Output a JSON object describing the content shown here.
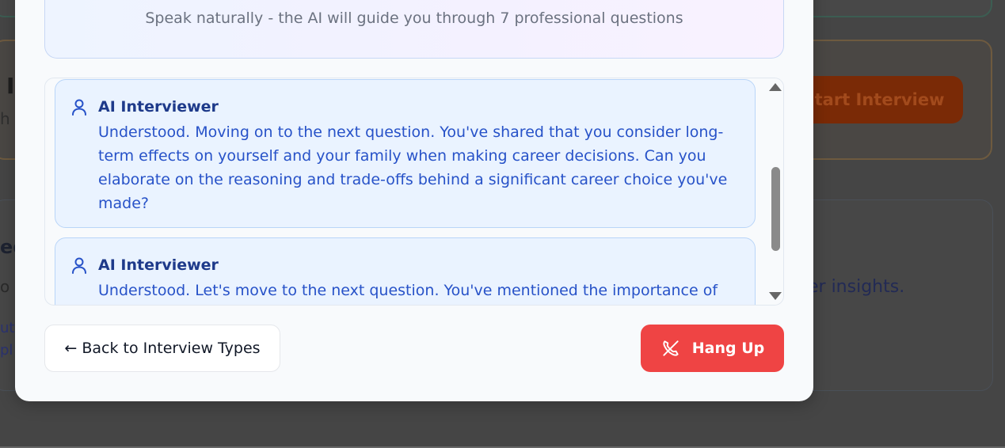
{
  "background": {
    "heading_fragment": "I",
    "sub_fragment": "h",
    "start_button_label": "Start Interview",
    "section_fragment": "ed",
    "small_fragment1": "o",
    "small_fragment2": "ut",
    "small_fragment3": "pl",
    "insights_fragment": "er insights."
  },
  "modal": {
    "instruction": "Speak naturally - the AI will guide you through 7 professional questions",
    "messages": [
      {
        "sender": "AI Interviewer",
        "text": "Understood. Moving on to the next question. You've shared that you consider long-term effects on yourself and your family when making career decisions. Can you elaborate on the reasoning and trade-offs behind a significant career choice you've made?"
      },
      {
        "sender": "AI Interviewer",
        "text": "Understood. Let's move to the next question. You've mentioned the importance of"
      }
    ],
    "back_button_label": "← Back to Interview Types",
    "hangup_button_label": "Hang Up"
  },
  "colors": {
    "hangup": "#ef4444",
    "message_bg": "#eaf3ff",
    "message_text": "#2752c8",
    "sender_text": "#1e3a8a"
  },
  "icons": {
    "message_avatar": "user-icon",
    "hangup": "phone-off-icon"
  }
}
